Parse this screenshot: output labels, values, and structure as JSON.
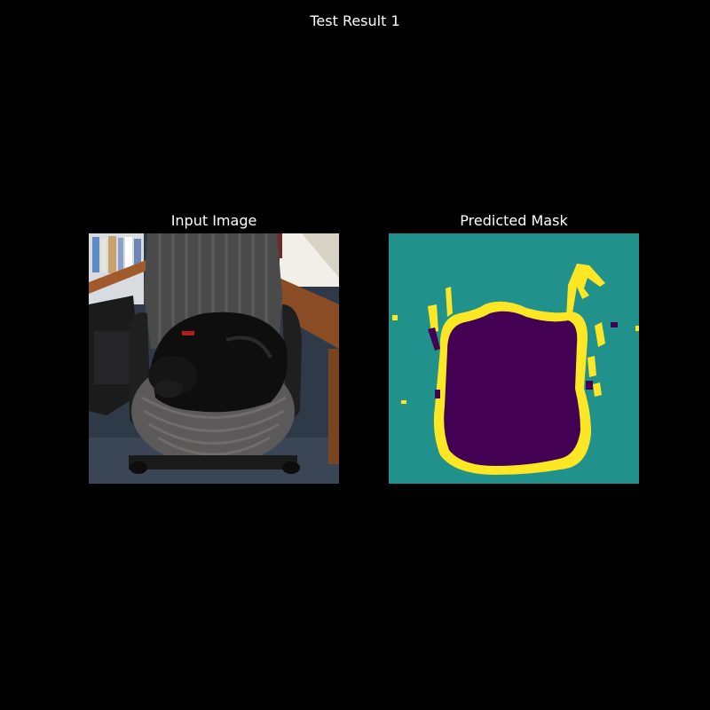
{
  "figure": {
    "title": "Test Result 1"
  },
  "panels": [
    {
      "title": "Input Image"
    },
    {
      "title": "Predicted Mask"
    }
  ],
  "colors": {
    "background": "#000000",
    "mask_background": "#21918c",
    "mask_boundary": "#fde725",
    "mask_foreground": "#440154"
  }
}
